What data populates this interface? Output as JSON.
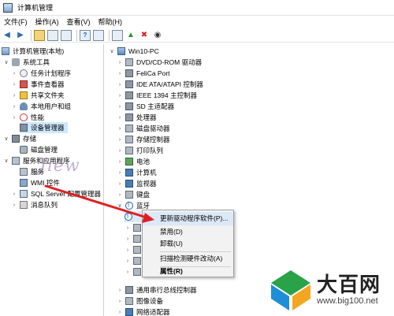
{
  "window": {
    "title": "计算机管理"
  },
  "menu": [
    {
      "label": "文件(F)"
    },
    {
      "label": "操作(A)"
    },
    {
      "label": "查看(V)"
    },
    {
      "label": "帮助(H)"
    }
  ],
  "left_tree": {
    "items": [
      {
        "label": "计算机管理(本地)",
        "icon": "computer-management-icon",
        "selected": false
      },
      {
        "label": "系统工具",
        "icon": "system-tools-icon",
        "selected": false
      },
      {
        "label": "任务计划程序",
        "icon": "task-scheduler-icon",
        "selected": false
      },
      {
        "label": "事件查看器",
        "icon": "event-viewer-icon",
        "selected": false
      },
      {
        "label": "共享文件夹",
        "icon": "shared-folders-icon",
        "selected": false
      },
      {
        "label": "本地用户和组",
        "icon": "local-users-icon",
        "selected": false
      },
      {
        "label": "性能",
        "icon": "performance-icon",
        "selected": false
      },
      {
        "label": "设备管理器",
        "icon": "device-manager-icon",
        "selected": true
      },
      {
        "label": "存储",
        "icon": "storage-icon",
        "selected": false
      },
      {
        "label": "磁盘管理",
        "icon": "disk-management-icon",
        "selected": false
      },
      {
        "label": "服务和应用程序",
        "icon": "services-applications-icon",
        "selected": false
      },
      {
        "label": "服务",
        "icon": "services-icon",
        "selected": false
      },
      {
        "label": "WMI 控件",
        "icon": "wmi-control-icon",
        "selected": false
      },
      {
        "label": "SQL Server 配置管理器",
        "icon": "sql-server-icon",
        "selected": false
      },
      {
        "label": "消息队列",
        "icon": "message-queue-icon",
        "selected": false
      }
    ]
  },
  "device_tree": {
    "root": "Win10-PC",
    "items": [
      {
        "label": "DVD/CD-ROM 驱动器"
      },
      {
        "label": "FeliCa Port"
      },
      {
        "label": "IDE ATA/ATAPI 控制器"
      },
      {
        "label": "IEEE 1394 主控制器"
      },
      {
        "label": "SD 主适配器"
      },
      {
        "label": "处理器"
      },
      {
        "label": "磁盘驱动器"
      },
      {
        "label": "存储控制器"
      },
      {
        "label": "打印队列"
      },
      {
        "label": "电池"
      },
      {
        "label": "计算机"
      },
      {
        "label": "监视器"
      },
      {
        "label": "键盘"
      },
      {
        "label": "蓝牙"
      }
    ],
    "bottom_items": [
      {
        "label": "通用串行总线控制器"
      },
      {
        "label": "图像设备"
      },
      {
        "label": "网络适配器"
      }
    ]
  },
  "context_menu": {
    "items": [
      {
        "label": "更新驱动程序软件(P)..."
      },
      {
        "label": "禁用(D)"
      },
      {
        "label": "卸载(U)"
      },
      {
        "label": "扫描检测硬件改动(A)"
      },
      {
        "label": "属性(R)"
      }
    ]
  },
  "watermark": {
    "brand_name": "大百网",
    "brand_url": "www.big100.net"
  },
  "colors": {
    "selection": "#cde8ff",
    "arrow": "#e02020",
    "menu_highlight": "#dbe8f7"
  }
}
